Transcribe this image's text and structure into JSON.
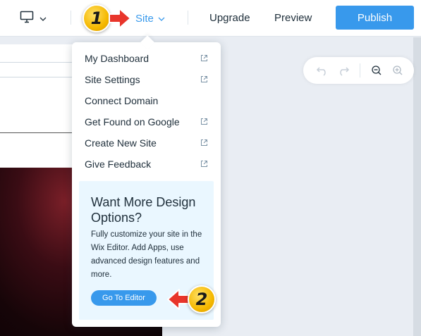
{
  "topbar": {
    "device_icon": "desktop-icon",
    "site_label": "Site",
    "upgrade_label": "Upgrade",
    "preview_label": "Preview",
    "publish_label": "Publish"
  },
  "site_menu": {
    "items": [
      {
        "label": "My Dashboard",
        "external": true
      },
      {
        "label": "Site Settings",
        "external": true
      },
      {
        "label": "Connect Domain",
        "external": false
      },
      {
        "label": "Get Found on Google",
        "external": true
      },
      {
        "label": "Create New Site",
        "external": true
      },
      {
        "label": "Give Feedback",
        "external": true
      }
    ],
    "promo": {
      "title": "Want More Design Options?",
      "text": "Fully customize your site in the Wix Editor. Add Apps, use advanced design features and more.",
      "button_label": "Go To Editor"
    }
  },
  "annotations": {
    "step1": "1",
    "step2": "2"
  },
  "colors": {
    "accent": "#3899ec",
    "promo_bg": "#eaf7ff",
    "badge": "#f5b800",
    "arrow": "#e8352b"
  }
}
